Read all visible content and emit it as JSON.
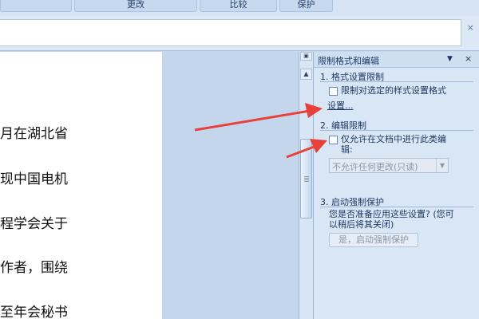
{
  "ribbon": {
    "groups": [
      "",
      "更改",
      "比较",
      "保护"
    ]
  },
  "msgbar": {
    "close_glyph": "×"
  },
  "document": {
    "lines": [
      "月在湖北省",
      "现中国电机",
      "程学会关于",
      "作者，围绕",
      "至年会秘书"
    ]
  },
  "scrollbar": {
    "up_glyph": "▲"
  },
  "pane": {
    "title": "限制格式和编辑",
    "menu_glyph": "▼",
    "close_glyph": "×",
    "section1": {
      "title": "1. 格式设置限制",
      "option": "限制对选定的样式设置格式",
      "link": "设置..."
    },
    "section2": {
      "title": "2. 编辑限制",
      "option_line1": "仅允许在文档中进行此类编",
      "option_line2": "辑:",
      "select_value": "不允许任何更改(只读)",
      "select_arrow": "▼"
    },
    "section3": {
      "title": "3. 启动强制保护",
      "desc_line1": "您是否准备应用这些设置? (您可",
      "desc_line2": "以稍后将其关闭)",
      "button": "是，启动强制保护"
    }
  },
  "colors": {
    "arrow": "#e8403a",
    "pane_bg": "#d9e6f5",
    "text_blue": "#1e3863"
  }
}
